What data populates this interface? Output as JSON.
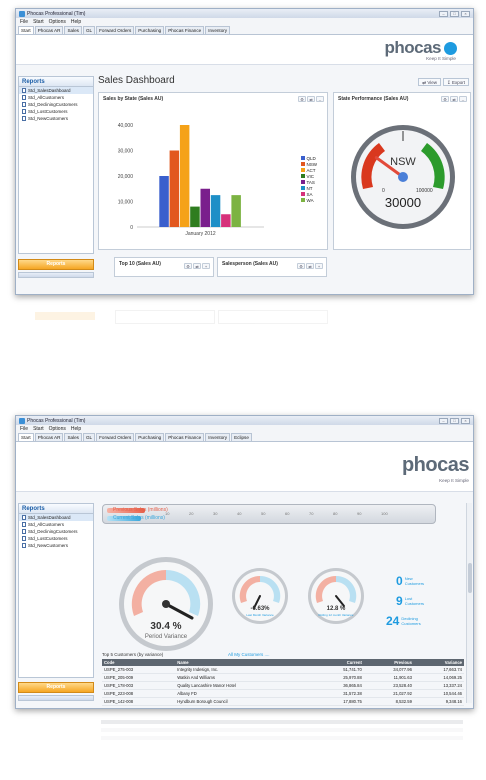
{
  "shot1": {
    "window_title": "Phocas Professional (Tim)",
    "menu": [
      "File",
      "Start",
      "Options",
      "Help"
    ],
    "tabs": [
      "Start",
      "Phocas AR",
      "Sales",
      "GL",
      "Forward Orders",
      "Purchasing",
      "Phocas Finance",
      "Inventory"
    ],
    "logo_text": "phocas",
    "logo_tagline": "Keep It Simple",
    "sidebar_title": "Reports",
    "sidebar_items": [
      "Std_SalesDashboard",
      "Std_AllCustomers",
      "Std_DecliningCustomers",
      "Std_LostCustomers",
      "Std_NewCustomers"
    ],
    "sidebar_footer": "Reports",
    "dashboard_title": "Sales Dashboard",
    "view_button": "View",
    "export_button": "Export",
    "panel_sales_by_state": "Sales by State (Sales AU)",
    "panel_state_performance": "State Performance (Sales AU)",
    "panel_top10": "Top 10 (Sales AU)",
    "panel_salesperson": "Salesperson (Sales AU)",
    "gauge_label": "NSW",
    "gauge_min": "0",
    "gauge_max": "100000",
    "gauge_value": "30000",
    "gauge_value_num": 30000,
    "gauge_max_num": 100000
  },
  "chart_data": {
    "type": "bar",
    "title": "Sales by State (Sales AU)",
    "categories": [
      "January 2012"
    ],
    "series": [
      {
        "name": "QLD",
        "values": [
          20000
        ],
        "color": "#3a5fcd"
      },
      {
        "name": "NSW",
        "values": [
          30000
        ],
        "color": "#e2571e"
      },
      {
        "name": "ACT",
        "values": [
          40000
        ],
        "color": "#f5a218"
      },
      {
        "name": "VIC",
        "values": [
          8000
        ],
        "color": "#2f7d1f"
      },
      {
        "name": "TAS",
        "values": [
          15000
        ],
        "color": "#7a1f8c"
      },
      {
        "name": "NT",
        "values": [
          12500
        ],
        "color": "#1d8fc7"
      },
      {
        "name": "SA",
        "values": [
          5000
        ],
        "color": "#d6317a"
      },
      {
        "name": "WA",
        "values": [
          12500
        ],
        "color": "#7cb342"
      }
    ],
    "yticks": [
      "0",
      "10,000",
      "20,000",
      "30,000",
      "40,000"
    ],
    "ylim": [
      0,
      40000
    ],
    "xlabel": "January 2012",
    "legend": "right"
  },
  "shot2": {
    "window_title": "Phocas Professional (Tim)",
    "menu": [
      "File",
      "Start",
      "Options",
      "Help"
    ],
    "tabs": [
      "Start",
      "Phocas AR",
      "Sales",
      "GL",
      "Forward Orders",
      "Purchasing",
      "Phocas Finance",
      "Inventory",
      "Eclipse"
    ],
    "logo_text": "phocas",
    "logo_tagline": "Keep It Simple",
    "sidebar_title": "Reports",
    "sidebar_items": [
      "Std_SalesDashboard",
      "Std_AllCustomers",
      "Std_DecliningCustomers",
      "Std_LostCustomers",
      "Std_NewCustomers"
    ],
    "sidebar_footer": "Reports",
    "bar1_label": "Previous Sales (millions)",
    "bar2_label": "Current Sales (millions)",
    "scale_ticks": [
      "10",
      "20",
      "30",
      "40",
      "50",
      "60",
      "70",
      "80",
      "90",
      "100"
    ],
    "gauge_big_value": "30.4 %",
    "gauge_big_label": "Period Variance",
    "gauge_mid_value": "-6.63%",
    "gauge_mid_label": "Last Month Variance",
    "gauge_right_value": "12.8 %",
    "gauge_right_label": "Rolling 12 month Variance",
    "kpis": [
      {
        "num": "0",
        "label1": "New",
        "label2": "Customers"
      },
      {
        "num": "9",
        "label1": "Lost",
        "label2": "Customers"
      },
      {
        "num": "24",
        "label1": "Declining",
        "label2": "Customers"
      }
    ],
    "table_title": "Top 5 Customers (by variance)",
    "table_link": "All My Customers ....",
    "table_headers": [
      "Code",
      "Name",
      "Current",
      "Previous",
      "Variance"
    ],
    "table_rows": [
      [
        "USPE_275-003",
        "Integrity Indesign, Inc.",
        "51,741.70",
        "34,077.96",
        "17,663.74"
      ],
      [
        "USPE_205-009",
        "Watkin And Williams",
        "25,970.88",
        "11,901.63",
        "14,069.25"
      ],
      [
        "USPE_178-003",
        "Quality Lancashire Manor Hotel",
        "36,865.84",
        "23,528.40",
        "13,337.24"
      ],
      [
        "USPE_223-008",
        "Albany FD",
        "31,572.38",
        "21,027.92",
        "10,544.46"
      ],
      [
        "USPE_142-008",
        "Hyndburn Borough Council",
        "17,880.75",
        "8,532.59",
        "9,348.16"
      ]
    ]
  }
}
